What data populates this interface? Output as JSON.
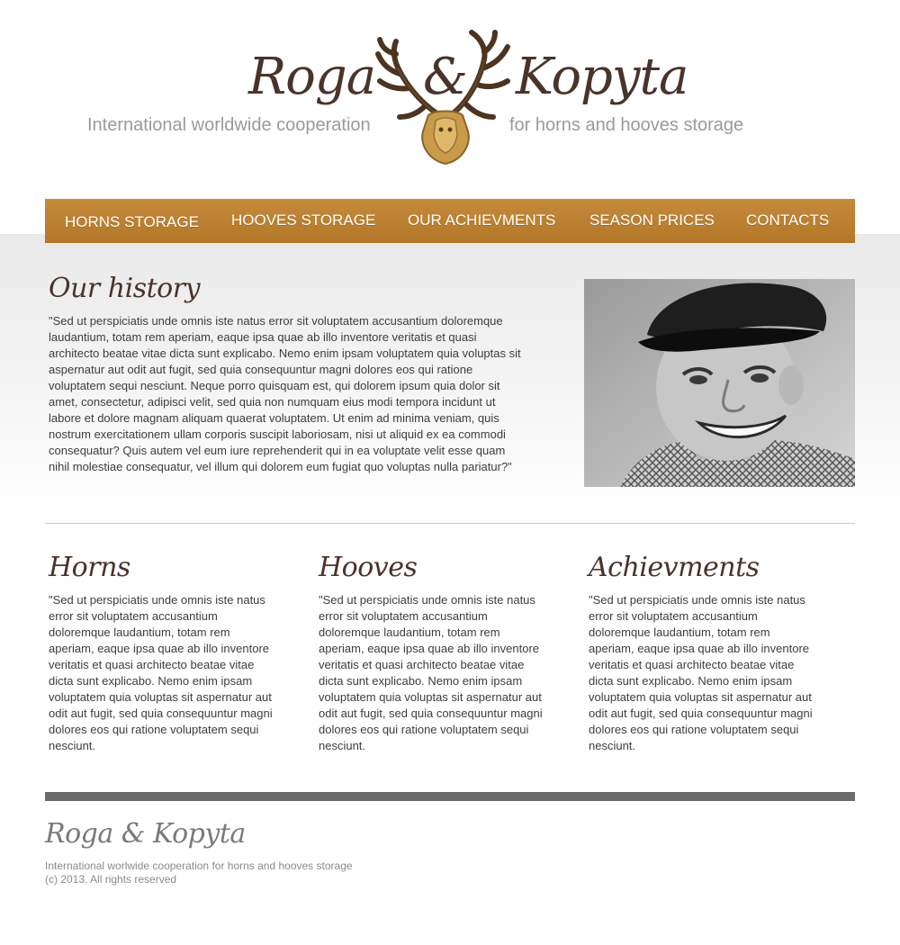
{
  "header": {
    "logo_left": "Roga",
    "logo_amp": "&",
    "logo_right": "Kopyta",
    "tagline_left": "International worldwide cooperation",
    "tagline_right": "for horns and hooves storage",
    "logo_icon": "antlers-trophy-icon"
  },
  "nav": {
    "items": [
      {
        "label": "HORNS STORAGE"
      },
      {
        "label": "HOOVES STORAGE"
      },
      {
        "label": "OUR ACHIEVMENTS"
      },
      {
        "label": "SEASON PRICES"
      },
      {
        "label": "CONTACTS"
      }
    ]
  },
  "history": {
    "title": "Our history",
    "text": "\"Sed ut perspiciatis unde omnis iste natus error sit voluptatem accusantium doloremque laudantium, totam rem aperiam, eaque ipsa quae ab illo inventore veritatis et quasi architecto beatae vitae dicta sunt explicabo. Nemo enim ipsam voluptatem quia voluptas sit aspernatur aut odit aut fugit, sed quia consequuntur magni dolores eos qui ratione voluptatem sequi nesciunt. Neque porro quisquam est, qui dolorem ipsum quia dolor sit amet, consectetur, adipisci velit, sed quia non numquam eius modi tempora incidunt ut labore et dolore magnam aliquam quaerat voluptatem. Ut enim ad minima veniam, quis nostrum exercitationem ullam corporis suscipit laboriosam, nisi ut aliquid ex ea commodi consequatur? Quis autem vel eum iure reprehenderit qui in ea voluptate velit esse quam nihil molestiae consequatur, vel illum qui dolorem eum fugiat quo voluptas nulla pariatur?\""
  },
  "columns": [
    {
      "title": "Horns",
      "text": "\"Sed ut perspiciatis unde omnis iste natus error sit voluptatem accusantium doloremque laudantium, totam rem aperiam, eaque ipsa quae ab illo inventore veritatis et quasi architecto beatae vitae dicta sunt explicabo. Nemo enim ipsam voluptatem quia voluptas sit aspernatur aut odit aut fugit, sed quia consequuntur magni dolores eos qui ratione voluptatem sequi nesciunt."
    },
    {
      "title": "Hooves",
      "text": "\"Sed ut perspiciatis unde omnis iste natus error sit voluptatem accusantium doloremque laudantium, totam rem aperiam, eaque ipsa quae ab illo inventore veritatis et quasi architecto beatae vitae dicta sunt explicabo. Nemo enim ipsam voluptatem quia voluptas sit aspernatur aut odit aut fugit, sed quia consequuntur magni dolores eos qui ratione voluptatem sequi nesciunt."
    },
    {
      "title": "Achievments",
      "text": "\"Sed ut perspiciatis unde omnis iste natus error sit voluptatem accusantium doloremque laudantium, totam rem aperiam, eaque ipsa quae ab illo inventore veritatis et quasi architecto beatae vitae dicta sunt explicabo. Nemo enim ipsam voluptatem quia voluptas sit aspernatur aut odit aut fugit, sed quia consequuntur magni dolores eos qui ratione voluptatem sequi nesciunt."
    }
  ],
  "footer": {
    "logo": "Roga & Kopyta",
    "tagline": "International worlwide cooperation for horns and hooves storage",
    "copyright": "(c) 2013. All rights reserved"
  },
  "colors": {
    "nav_bar": "#b97d2e",
    "heading": "#4a3329",
    "footer_bar": "#6b6b6b"
  }
}
